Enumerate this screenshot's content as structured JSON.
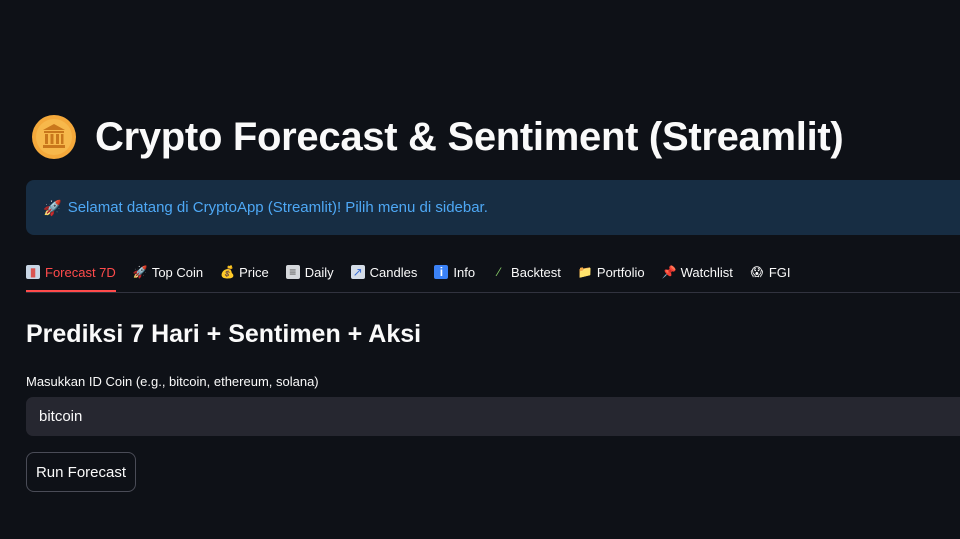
{
  "header": {
    "title_icon": "bank-coin-icon",
    "title": "Crypto Forecast & Sentiment (Streamlit)"
  },
  "banner": {
    "icon": "rocket-icon",
    "text": "Selamat datang di CryptoApp (Streamlit)! Pilih menu di sidebar."
  },
  "tabs": [
    {
      "label": "Forecast 7D",
      "icon": "bar-chart-icon",
      "active": true
    },
    {
      "label": "Top Coin",
      "icon": "rocket-icon",
      "active": false
    },
    {
      "label": "Price",
      "icon": "money-bag-icon",
      "active": false
    },
    {
      "label": "Daily",
      "icon": "newspaper-icon",
      "active": false
    },
    {
      "label": "Candles",
      "icon": "chart-increasing-icon",
      "active": false
    },
    {
      "label": "Info",
      "icon": "info-icon",
      "active": false
    },
    {
      "label": "Backtest",
      "icon": "test-tube-icon",
      "active": false
    },
    {
      "label": "Portfolio",
      "icon": "folder-icon",
      "active": false
    },
    {
      "label": "Watchlist",
      "icon": "pushpin-icon",
      "active": false
    },
    {
      "label": "FGI",
      "icon": "scream-face-icon",
      "active": false
    }
  ],
  "main": {
    "subheader": "Prediksi 7 Hari + Sentimen + Aksi",
    "coin_input": {
      "label": "Masukkan ID Coin (e.g., bitcoin, ethereum, solana)",
      "value": "bitcoin"
    },
    "run_button_label": "Run Forecast"
  },
  "colors": {
    "background": "#0e1117",
    "accent": "#ff4b4b",
    "info_background": "#172d43",
    "info_text": "#4ea8f5",
    "input_background": "#262730"
  }
}
